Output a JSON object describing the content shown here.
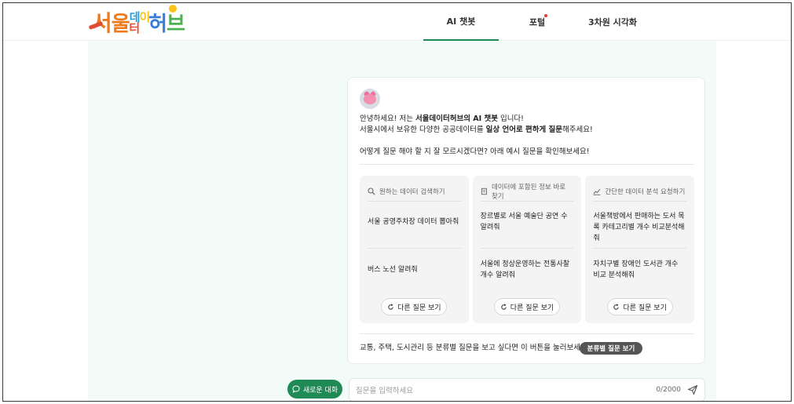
{
  "header": {
    "logo_chars": [
      "서",
      "울",
      "데",
      "이",
      "터",
      "허",
      "브"
    ],
    "logo_alt": "서울데이터허브",
    "nav": [
      {
        "label": "AI 챗봇",
        "active": true,
        "badge": false
      },
      {
        "label": "포털",
        "active": false,
        "badge": true
      },
      {
        "label": "3차원 시각화",
        "active": false,
        "badge": false
      }
    ]
  },
  "chat": {
    "greeting": {
      "l1_pre": "안녕하세요! 저는 ",
      "l1_bold": "서울데이터허브의 AI 챗봇",
      "l1_post": " 입니다!",
      "l2_pre": "서울시에서 보유한 다양한 공공데이터를 ",
      "l2_bold": "일상 언어로 편하게 질문",
      "l2_post": "해주세요!",
      "l3": "어떻게 질문 해야 할 지 잘 모르시겠다면? 아래 예시 질문을 확인해보세요!"
    },
    "columns": [
      {
        "icon": "search-data-icon",
        "title": "원하는 데이터 검색하기",
        "q1": "서울 공영주차장 데이터 뽑아줘",
        "q2": "버스 노선 알려줘",
        "more": "다른 질문 보기"
      },
      {
        "icon": "document-icon",
        "title": "데이터에 포함된 정보 바로 찾기",
        "q1": "장르별로 서울 예술단 공연 수 알려줘",
        "q2": "서울에 정상운영하는 전통사찰 개수 알려줘",
        "more": "다른 질문 보기"
      },
      {
        "icon": "chart-icon",
        "title": "간단한 데이터 분석 요청하기",
        "q1": "서울책방에서 판매하는 도서 목록 카테고리별 개수 비교분석해줘",
        "q2": "자치구별 장애인 도서관 개수 비교 분석해줘",
        "more": "다른 질문 보기"
      }
    ],
    "bottom_text": "교통, 주택, 도시관리 등 분류별 질문을 보고 싶다면 이 버튼을 눌러보세요!",
    "category_button": "분류별 질문 보기"
  },
  "input": {
    "new_chat_label": "새로운 대화",
    "placeholder": "질문을 입력하세요",
    "counter": "0/2000"
  },
  "colors": {
    "accent": "#1f8a55",
    "page_bg": "#f3fbf8",
    "badge": "#e53935"
  }
}
